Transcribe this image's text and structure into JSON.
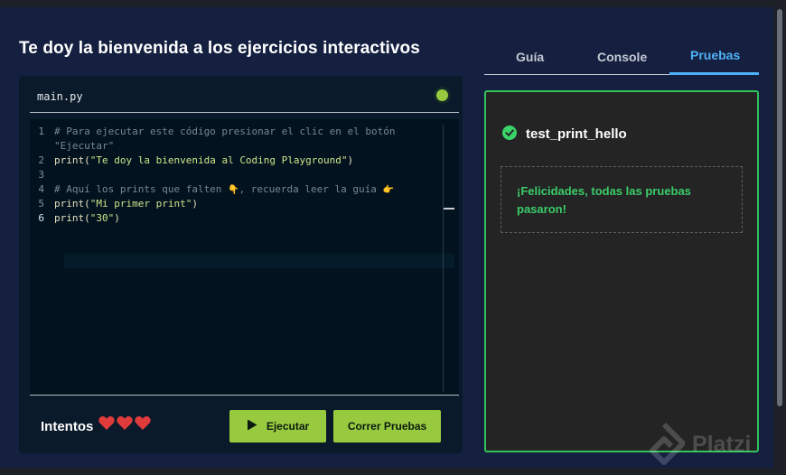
{
  "page": {
    "title": "Te doy la bienvenida a los ejercicios interactivos"
  },
  "editor": {
    "file_name": "main.py",
    "status_color": "#98ca3f",
    "lines": [
      {
        "num": "1",
        "parts": [
          {
            "text": "# Para ejecutar este código presionar el clic en el botón",
            "kind": "comment"
          }
        ]
      },
      {
        "num": "",
        "parts": [
          {
            "text": "\"Ejecutar\"",
            "kind": "comment"
          }
        ]
      },
      {
        "num": "2",
        "parts": [
          {
            "text": "print(",
            "kind": "keyword"
          },
          {
            "text": "\"Te doy la bienvenida al Coding Playground\"",
            "kind": "string"
          },
          {
            "text": ")",
            "kind": "keyword"
          }
        ]
      },
      {
        "num": "3",
        "parts": []
      },
      {
        "num": "4",
        "parts": [
          {
            "text": "# Aquí los prints que falten ",
            "kind": "comment"
          },
          {
            "text": "👇",
            "kind": "emoji"
          },
          {
            "text": ", recuerda leer la guía ",
            "kind": "comment"
          },
          {
            "text": "👉",
            "kind": "emoji"
          }
        ]
      },
      {
        "num": "5",
        "parts": [
          {
            "text": "print(",
            "kind": "keyword"
          },
          {
            "text": "\"Mi primer print\"",
            "kind": "string"
          },
          {
            "text": ")",
            "kind": "keyword"
          }
        ]
      },
      {
        "num": "6",
        "parts": [
          {
            "text": "print(",
            "kind": "keyword"
          },
          {
            "text": "\"30\"",
            "kind": "string"
          },
          {
            "text": ")",
            "kind": "keyword"
          }
        ]
      }
    ],
    "active_line": "6"
  },
  "footer": {
    "attempts_label": "Intentos",
    "hearts": 3,
    "heart_color": "#e03b3b",
    "run_label": "Ejecutar",
    "tests_label": "Correr Pruebas",
    "button_color": "#98ca3f"
  },
  "tabs": [
    {
      "label": "Guía",
      "active": false
    },
    {
      "label": "Console",
      "active": false
    },
    {
      "label": "Pruebas",
      "active": true
    }
  ],
  "results": {
    "test_name": "test_print_hello",
    "status": "passed",
    "message": "¡Felicidades, todas las pruebas pasaron!",
    "accent_color": "#32c25a"
  },
  "watermark": {
    "text": "Platzi"
  }
}
